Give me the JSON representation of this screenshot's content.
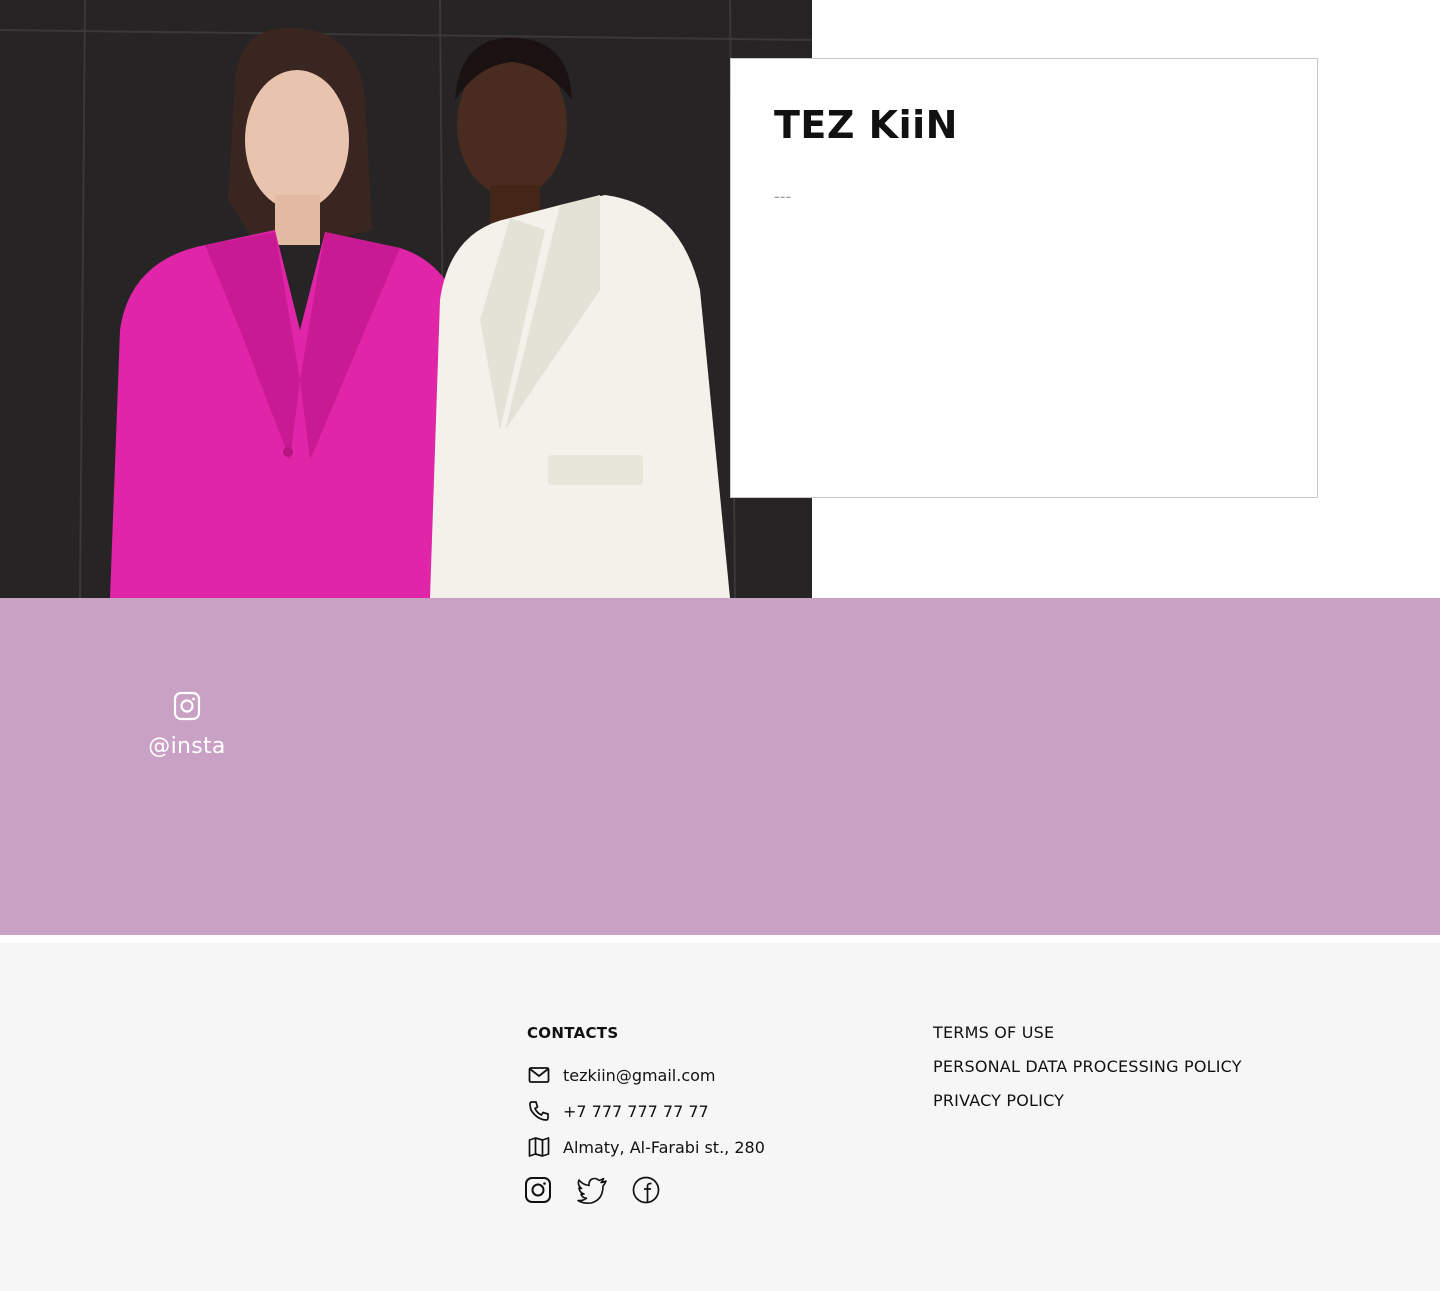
{
  "hero": {
    "title": "TEZ KiiN",
    "subtitle": "---",
    "image_alt": "Two models wearing a magenta blazer and a white blazer"
  },
  "instagram": {
    "icon": "instagram-icon",
    "handle": "@insta"
  },
  "footer": {
    "contacts": {
      "heading": "CONTACTS",
      "email": "tezkiin@gmail.com",
      "phone": "+7 777 777 77 77",
      "address": "Almaty, Al-Farabi st.,  280"
    },
    "social_icons": [
      "instagram-icon",
      "twitter-icon",
      "facebook-icon"
    ],
    "links": [
      "TERMS OF USE",
      "PERSONAL DATA PROCESSING POLICY",
      "PRIVACY POLICY"
    ]
  },
  "colors": {
    "band": "#c9a1c4",
    "footer_bg": "#f6f6f6",
    "magenta_blazer": "#e025a8",
    "white_blazer": "#f3f1e9"
  }
}
